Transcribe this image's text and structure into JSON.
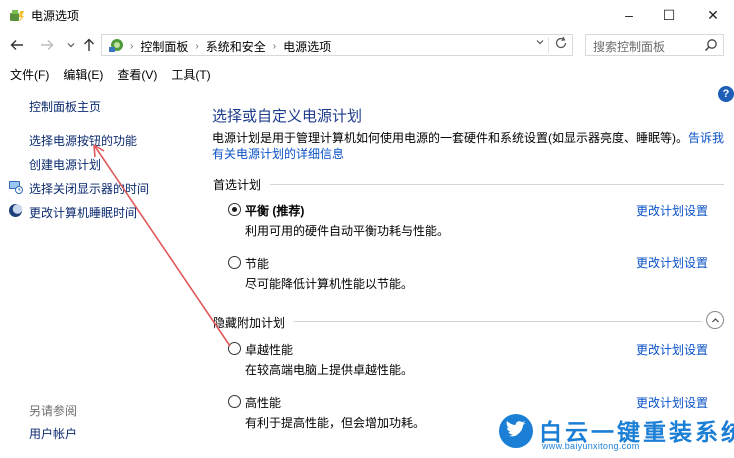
{
  "window": {
    "title": "电源选项",
    "icon": "power-options-icon",
    "controls": {
      "minimize": "–",
      "maximize": "☐",
      "close": "✕"
    }
  },
  "navigation": {
    "back_icon": "arrow-left-icon",
    "forward_icon": "arrow-right-icon",
    "up_icon": "arrow-up-icon",
    "breadcrumbs": [
      "控制面板",
      "系统和安全",
      "电源选项"
    ],
    "search_placeholder": "搜索控制面板"
  },
  "menu": [
    "文件(F)",
    "编辑(E)",
    "查看(V)",
    "工具(T)"
  ],
  "sidebar": {
    "items": [
      {
        "label": "控制面板主页",
        "icon": ""
      },
      {
        "label": "选择电源按钮的功能",
        "icon": ""
      },
      {
        "label": "创建电源计划",
        "icon": ""
      },
      {
        "label": "选择关闭显示器的时间",
        "icon": "monitor-clock-icon"
      },
      {
        "label": "更改计算机睡眠时间",
        "icon": "moon-icon"
      }
    ],
    "see_also_title": "另请参阅",
    "see_also": [
      {
        "label": "用户帐户"
      }
    ]
  },
  "main": {
    "title": "选择或自定义电源计划",
    "description": "电源计划是用于管理计算机如何使用电源的一套硬件和系统设置(如显示器亮度、睡眠等)。",
    "description_link_1": "告诉我有关",
    "description_link_2": "电源计划的详细信息",
    "preferred_header": "首选计划",
    "hidden_header": "隐藏附加计划",
    "plans": [
      {
        "name": "平衡 (推荐)",
        "desc": "利用可用的硬件自动平衡功耗与性能。",
        "selected": true,
        "link": "更改计划设置"
      },
      {
        "name": "节能",
        "desc": "尽可能降低计算机性能以节能。",
        "selected": false,
        "link": "更改计划设置"
      }
    ],
    "hidden_plans": [
      {
        "name": "卓越性能",
        "desc": "在较高端电脑上提供卓越性能。",
        "selected": false,
        "link": "更改计划设置"
      },
      {
        "name": "高性能",
        "desc": "有利于提高性能，但会增加功耗。",
        "selected": false,
        "link": "更改计划设置"
      }
    ]
  },
  "watermark": {
    "title": "白云一键重装系统",
    "url": "www.baiyunxitong.com",
    "accent": "#1c7fd6"
  },
  "colors": {
    "link": "#0a52c9",
    "title": "#1e3c8c",
    "annotation_arrow": "#e05a5a"
  }
}
